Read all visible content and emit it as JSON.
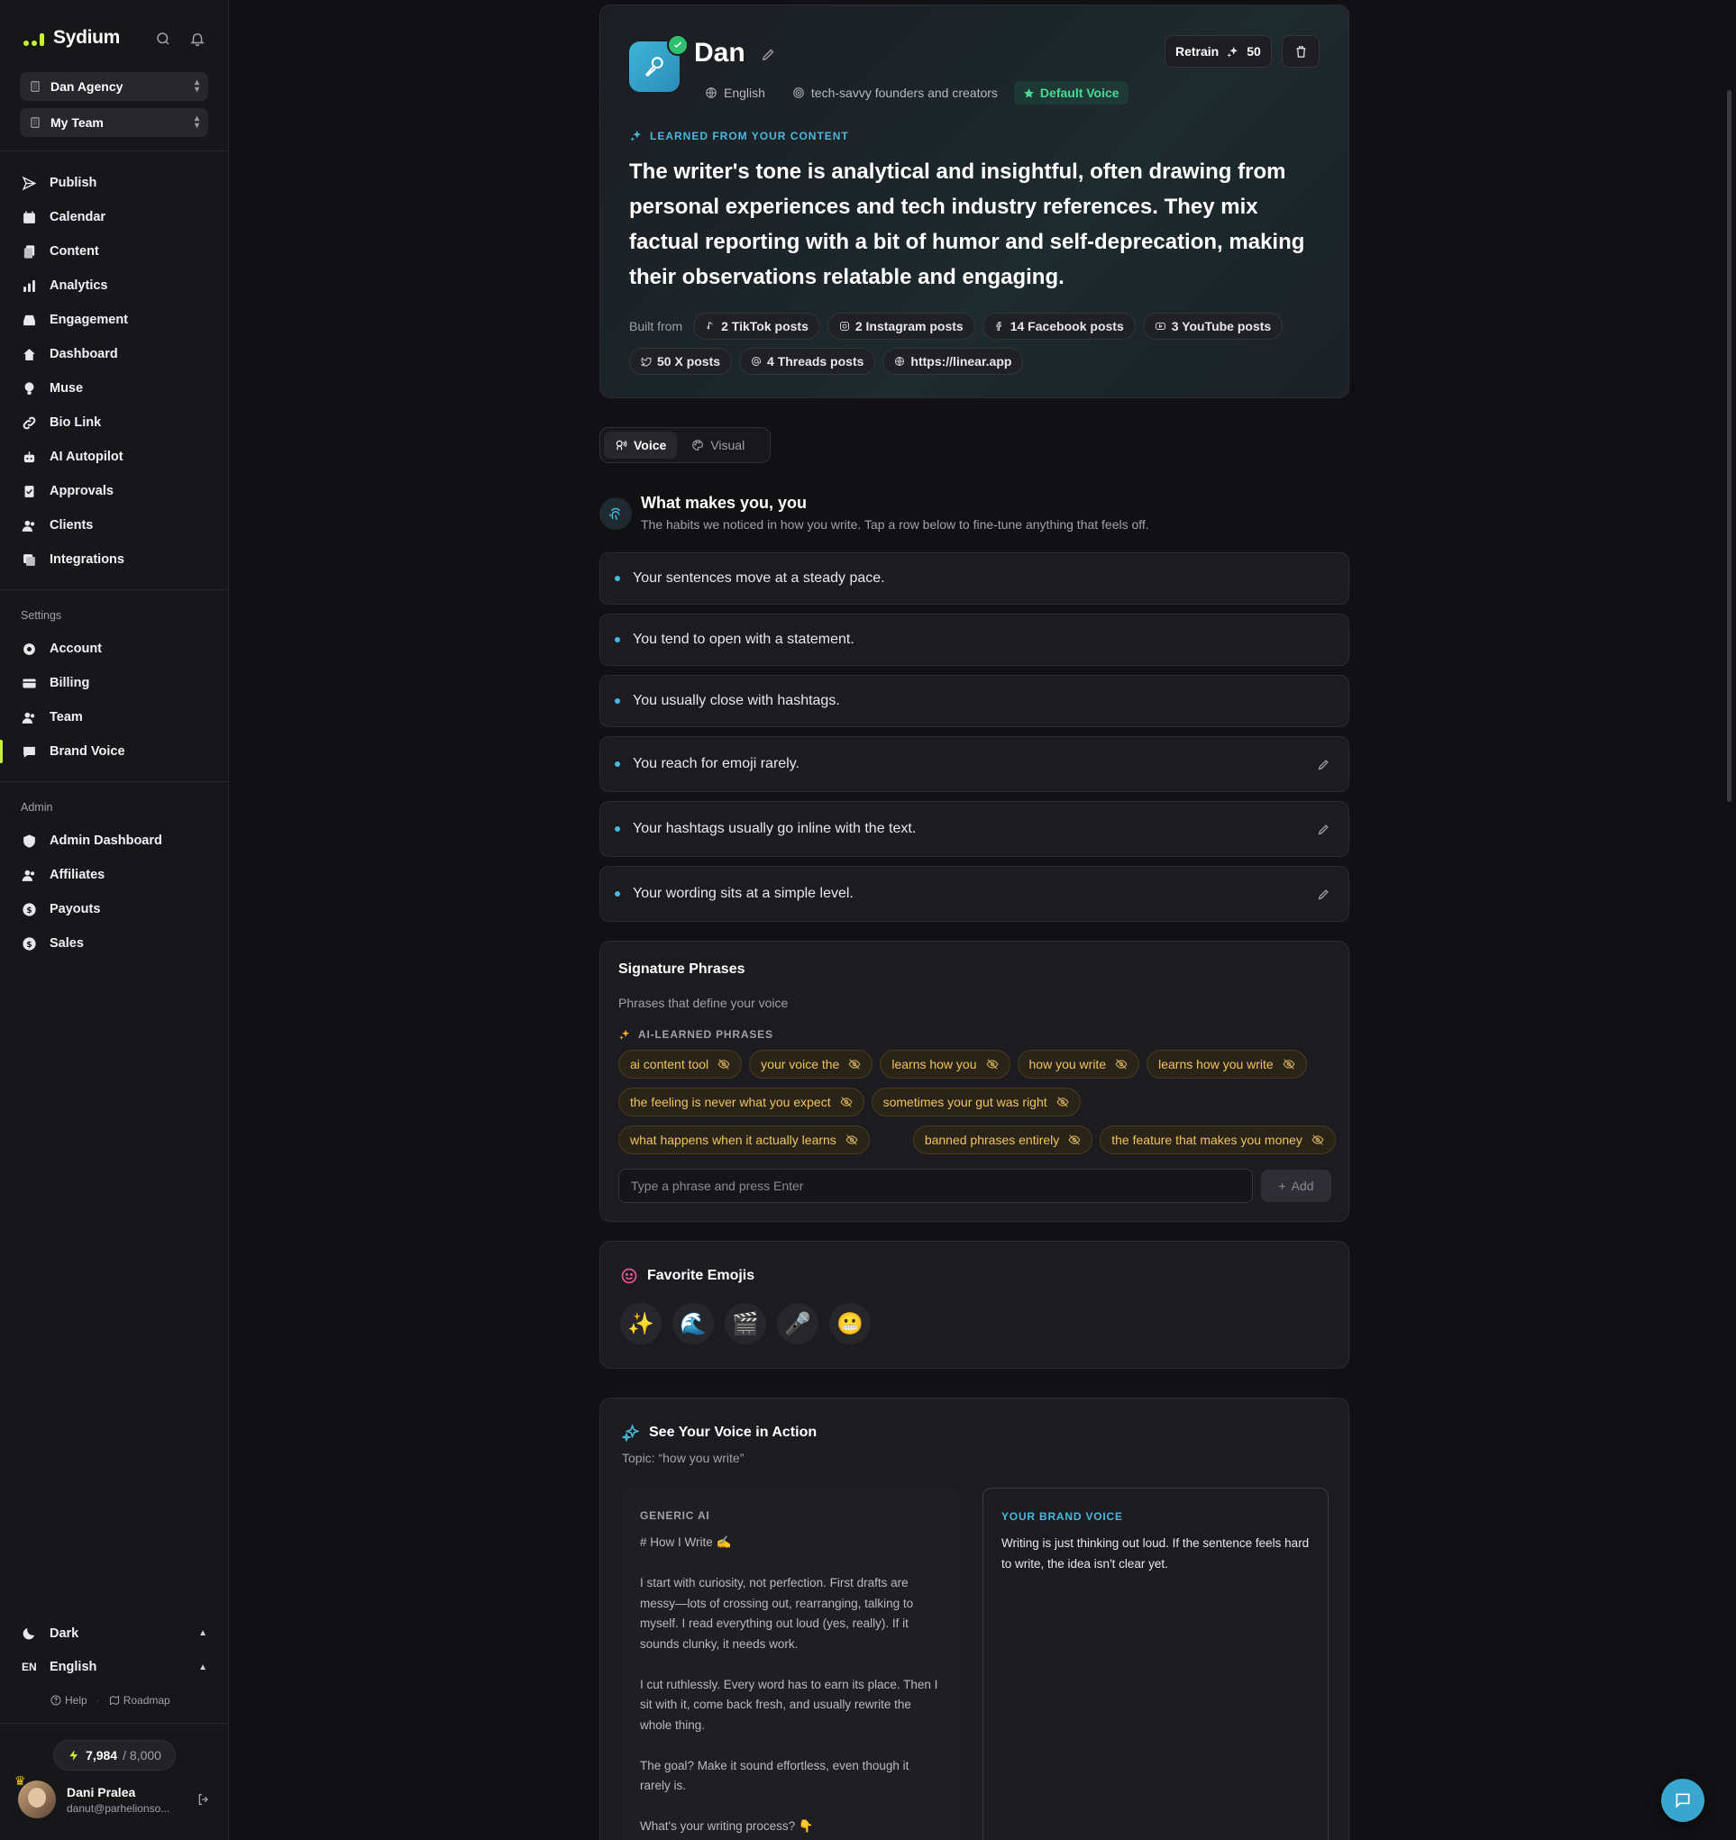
{
  "app": {
    "name": "Sydium",
    "brand_color": "#c8f03a"
  },
  "selectors": {
    "agency": "Dan Agency",
    "team": "My Team"
  },
  "nav": {
    "main": [
      {
        "label": "Publish",
        "icon": "send-icon"
      },
      {
        "label": "Calendar",
        "icon": "calendar-icon"
      },
      {
        "label": "Content",
        "icon": "content-icon"
      },
      {
        "label": "Analytics",
        "icon": "analytics-icon"
      },
      {
        "label": "Engagement",
        "icon": "inbox-icon"
      },
      {
        "label": "Dashboard",
        "icon": "home-icon"
      },
      {
        "label": "Muse",
        "icon": "lightbulb-icon"
      },
      {
        "label": "Bio Link",
        "icon": "link-icon"
      },
      {
        "label": "AI Autopilot",
        "icon": "bot-icon"
      },
      {
        "label": "Approvals",
        "icon": "approvals-icon"
      },
      {
        "label": "Clients",
        "icon": "clients-icon"
      },
      {
        "label": "Integrations",
        "icon": "integrations-icon"
      }
    ],
    "settings_label": "Settings",
    "settings": [
      {
        "label": "Account",
        "icon": "gear-icon"
      },
      {
        "label": "Billing",
        "icon": "credit-card-icon"
      },
      {
        "label": "Team",
        "icon": "team-icon"
      },
      {
        "label": "Brand Voice",
        "icon": "chat-bubble-icon",
        "active": true
      }
    ],
    "admin_label": "Admin",
    "admin": [
      {
        "label": "Admin Dashboard",
        "icon": "shield-icon"
      },
      {
        "label": "Affiliates",
        "icon": "affiliates-icon"
      },
      {
        "label": "Payouts",
        "icon": "dollar-icon"
      },
      {
        "label": "Sales",
        "icon": "sales-icon"
      }
    ]
  },
  "sidebar_bottom": {
    "theme": "Dark",
    "language_code": "EN",
    "language": "English",
    "help": "Help",
    "roadmap": "Roadmap",
    "credits_used": "7,984",
    "credits_total": "/ 8,000",
    "user_name": "Dani Pralea",
    "user_email": "danut@parhelionso..."
  },
  "voice": {
    "name": "Dan",
    "language": "English",
    "audience": "tech-savvy founders and creators",
    "default_label": "Default Voice",
    "retrain_label": "Retrain",
    "retrain_cost": "50",
    "learned_label": "LEARNED FROM YOUR CONTENT",
    "description": "The writer's tone is analytical and insightful, often drawing from personal experiences and tech industry references. They mix factual reporting with a bit of humor and self-deprecation, making their observations relatable and engaging.",
    "built_from_label": "Built from",
    "sources": [
      {
        "label": "2 TikTok posts",
        "icon": "tiktok-icon"
      },
      {
        "label": "2 Instagram posts",
        "icon": "instagram-icon"
      },
      {
        "label": "14 Facebook posts",
        "icon": "facebook-icon"
      },
      {
        "label": "3 YouTube posts",
        "icon": "youtube-icon"
      },
      {
        "label": "50 X posts",
        "icon": "x-icon"
      },
      {
        "label": "4 Threads posts",
        "icon": "threads-icon"
      },
      {
        "label": "https://linear.app",
        "icon": "globe-icon"
      }
    ]
  },
  "tabs": {
    "voice": "Voice",
    "visual": "Visual"
  },
  "traits": {
    "title": "What makes you, you",
    "subtitle": "The habits we noticed in how you write. Tap a row below to fine-tune anything that feels off.",
    "items": [
      {
        "text": "Your sentences move at a steady pace.",
        "editable": false
      },
      {
        "text": "You tend to open with a statement.",
        "editable": false
      },
      {
        "text": "You usually close with hashtags.",
        "editable": false
      },
      {
        "text": "You reach for emoji rarely.",
        "editable": true
      },
      {
        "text": "Your hashtags usually go inline with the text.",
        "editable": true
      },
      {
        "text": "Your wording sits at a simple level.",
        "editable": true
      }
    ]
  },
  "signature": {
    "title": "Signature Phrases",
    "subtitle": "Phrases that define your voice",
    "ai_label": "AI-LEARNED PHRASES",
    "phrases": [
      "ai content tool",
      "your voice the",
      "learns how you",
      "how you write",
      "learns how you write",
      "the feeling is never what you expect",
      "sometimes your gut was right",
      "what happens when it actually learns",
      "banned phrases entirely",
      "the feature that makes you money"
    ],
    "input_placeholder": "Type a phrase and press Enter",
    "add_label": "Add"
  },
  "emojis": {
    "title": "Favorite Emojis",
    "items": [
      "✨",
      "🌊",
      "🎬",
      "🎤",
      "😬"
    ]
  },
  "action": {
    "title": "See Your Voice in Action",
    "topic": "Topic: “how you write”",
    "generic_label": "GENERIC AI",
    "generic_text": "# How I Write ✍️\n\nI start with curiosity, not perfection. First drafts are messy—lots of crossing out, rearranging, talking to myself. I read everything out loud (yes, really). If it sounds clunky, it needs work.\n\nI cut ruthlessly. Every word has to earn its place. Then I sit with it, come back fresh, and usually rewrite the whole thing.\n\nThe goal? Make it sound effortless, even though it rarely is.\n\nWhat's your writing process? 👇",
    "brand_label": "YOUR BRAND VOICE",
    "brand_text": "Writing is just thinking out loud. If the sentence feels hard to write, the idea isn't clear yet."
  }
}
